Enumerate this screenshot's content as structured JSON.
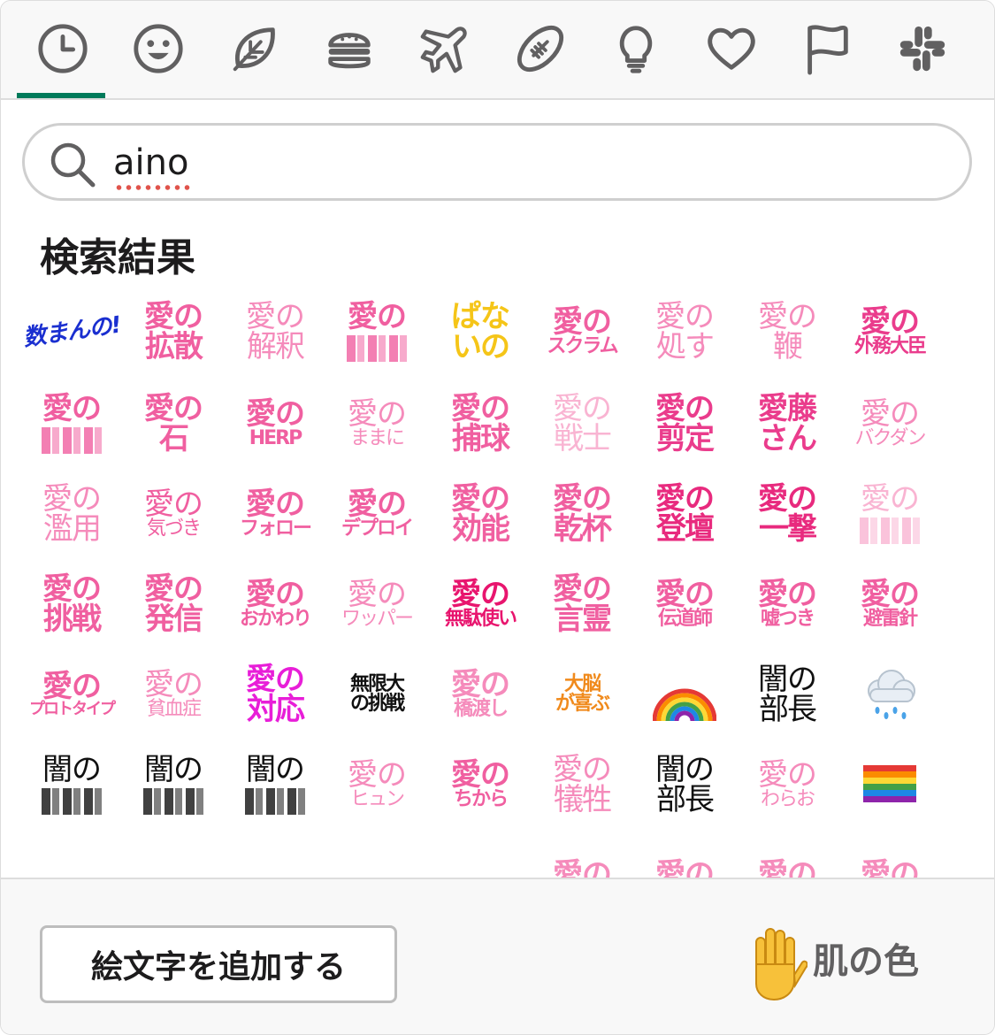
{
  "tabs": [
    {
      "name": "tab-recent",
      "icon": "clock-icon",
      "active": true
    },
    {
      "name": "tab-smileys",
      "icon": "smiley-icon"
    },
    {
      "name": "tab-nature",
      "icon": "leaf-icon"
    },
    {
      "name": "tab-food",
      "icon": "burger-icon"
    },
    {
      "name": "tab-travel",
      "icon": "airplane-icon"
    },
    {
      "name": "tab-activity",
      "icon": "football-icon"
    },
    {
      "name": "tab-objects",
      "icon": "lightbulb-icon"
    },
    {
      "name": "tab-symbols",
      "icon": "heart-icon"
    },
    {
      "name": "tab-flags",
      "icon": "flag-icon"
    },
    {
      "name": "tab-custom",
      "icon": "slack-icon"
    }
  ],
  "search": {
    "value": "aino",
    "placeholder": ""
  },
  "results": {
    "title": "検索結果",
    "items": [
      {
        "l1": "数まんの!",
        "l2": "",
        "color": "#1a2fd0",
        "style": "italic"
      },
      {
        "l1": "愛の",
        "l2": "拡散",
        "color": "#f05fa0"
      },
      {
        "l1": "愛の",
        "l2": "解釈",
        "color": "#f58bbb",
        "thin": true
      },
      {
        "l1": "愛の",
        "l2": "",
        "color": "#f05fa0",
        "blur": true
      },
      {
        "l1": "ぱな",
        "l2": "いの",
        "color": "#f5c518"
      },
      {
        "l1": "愛の",
        "l2": "スクラム",
        "color": "#f05fa0",
        "l2size": "sm"
      },
      {
        "l1": "愛の",
        "l2": "処す",
        "color": "#f58bbb",
        "thin": true
      },
      {
        "l1": "愛の",
        "l2": "鞭",
        "color": "#f58bbb",
        "thin": true
      },
      {
        "l1": "愛の",
        "l2": "外務大臣",
        "color": "#ea3c8c",
        "l2size": "sm"
      },
      {
        "l1": "愛の",
        "l2": "",
        "color": "#f05fa0",
        "blur": true
      },
      {
        "l1": "愛の",
        "l2": "石",
        "color": "#f05fa0"
      },
      {
        "l1": "愛の",
        "l2": "HERP",
        "color": "#f05fa0",
        "l2size": "sm"
      },
      {
        "l1": "愛の",
        "l2": "ままに",
        "color": "#f58bbb",
        "thin": true,
        "l2size": "sm"
      },
      {
        "l1": "愛の",
        "l2": "捕球",
        "color": "#f05fa0"
      },
      {
        "l1": "愛の",
        "l2": "戦士",
        "color": "#f9b4d2",
        "thin": true
      },
      {
        "l1": "愛の",
        "l2": "剪定",
        "color": "#ea3c8c"
      },
      {
        "l1": "愛藤",
        "l2": "さん",
        "color": "#ea3c8c"
      },
      {
        "l1": "愛の",
        "l2": "バクダン",
        "color": "#f58bbb",
        "thin": true,
        "l2size": "sm"
      },
      {
        "l1": "愛の",
        "l2": "濫用",
        "color": "#f58bbb",
        "thin": true
      },
      {
        "l1": "愛の",
        "l2": "気づき",
        "color": "#f05fa0",
        "thin": true,
        "l2size": "sm"
      },
      {
        "l1": "愛の",
        "l2": "フォロー",
        "color": "#f05fa0",
        "l2size": "sm"
      },
      {
        "l1": "愛の",
        "l2": "デプロイ",
        "color": "#f05fa0",
        "l2size": "sm"
      },
      {
        "l1": "愛の",
        "l2": "効能",
        "color": "#f05fa0"
      },
      {
        "l1": "愛の",
        "l2": "乾杯",
        "color": "#f05fa0"
      },
      {
        "l1": "愛の",
        "l2": "登壇",
        "color": "#e82a7e"
      },
      {
        "l1": "愛の",
        "l2": "一撃",
        "color": "#e82a7e"
      },
      {
        "l1": "愛の",
        "l2": "",
        "color": "#f9b4d2",
        "thin": true,
        "blur": true
      },
      {
        "l1": "愛の",
        "l2": "挑戦",
        "color": "#f05fa0"
      },
      {
        "l1": "愛の",
        "l2": "発信",
        "color": "#f05fa0"
      },
      {
        "l1": "愛の",
        "l2": "おかわり",
        "color": "#f05fa0",
        "l2size": "sm"
      },
      {
        "l1": "愛の",
        "l2": "ワッパー",
        "color": "#f58bbb",
        "thin": true,
        "l2size": "sm"
      },
      {
        "l1": "愛の",
        "l2": "無駄使い",
        "color": "#e8156e",
        "l2size": "sm"
      },
      {
        "l1": "愛の",
        "l2": "言霊",
        "color": "#f05fa0"
      },
      {
        "l1": "愛の",
        "l2": "伝道師",
        "color": "#f05fa0",
        "l2size": "sm"
      },
      {
        "l1": "愛の",
        "l2": "嘘つき",
        "color": "#f05fa0",
        "l2size": "sm"
      },
      {
        "l1": "愛の",
        "l2": "避雷針",
        "color": "#f05fa0",
        "l2size": "sm"
      },
      {
        "l1": "愛の",
        "l2": "プロトタイプ",
        "color": "#f05fa0",
        "l2size": "xs"
      },
      {
        "l1": "愛の",
        "l2": "貧血症",
        "color": "#f58bbb",
        "thin": true,
        "l2size": "sm"
      },
      {
        "l1": "愛の",
        "l2": "対応",
        "color": "#e81ed8"
      },
      {
        "l1": "無限大",
        "l2": "の挑戦",
        "color": "#111111",
        "l1size": "sm",
        "l2size": "sm"
      },
      {
        "l1": "愛の",
        "l2": "橋渡し",
        "color": "#f58bbb",
        "l2size": "sm"
      },
      {
        "l1": "大脳",
        "l2": "が喜ぶ",
        "color": "#f08a1c",
        "l1size": "sm",
        "l2size": "sm"
      },
      {
        "l1": "",
        "l2": "",
        "emoji": "rainbow-emoji"
      },
      {
        "l1": "闇の",
        "l2": "部長",
        "color": "#111111",
        "thin": true
      },
      {
        "l1": "",
        "l2": "",
        "emoji": "rain-cloud-emoji"
      },
      {
        "l1": "闇の",
        "l2": "",
        "color": "#111111",
        "thin": true,
        "blur": true
      },
      {
        "l1": "闇の",
        "l2": "",
        "color": "#111111",
        "thin": true,
        "blur": true
      },
      {
        "l1": "闇の",
        "l2": "",
        "color": "#111111",
        "thin": true,
        "blur": true
      },
      {
        "l1": "愛の",
        "l2": "ヒュン",
        "color": "#f58bbb",
        "thin": true,
        "l2size": "sm"
      },
      {
        "l1": "愛の",
        "l2": "ちから",
        "color": "#f05fa0",
        "l2size": "sm"
      },
      {
        "l1": "愛の",
        "l2": "犠牲",
        "color": "#f58bbb",
        "thin": true
      },
      {
        "l1": "闇の",
        "l2": "部長",
        "color": "#111111",
        "thin": true
      },
      {
        "l1": "愛の",
        "l2": "わらお",
        "color": "#f58bbb",
        "thin": true,
        "l2size": "sm"
      },
      {
        "l1": "",
        "l2": "",
        "emoji": "rainbow-flag-emoji"
      },
      {
        "l1": "",
        "l2": "",
        "emoji": "psychedelic-emoji"
      },
      {
        "l1": "",
        "l2": "",
        "emoji": "magenta-bars-emoji"
      },
      {
        "l1": "",
        "l2": "",
        "emoji": "orange-dot-emoji"
      },
      {
        "l1": "",
        "l2": "",
        "emoji": "blue-creature-emoji"
      },
      {
        "l1": "",
        "l2": "",
        "emoji": "yellow-box-emoji"
      },
      {
        "l1": "愛の",
        "l2": "",
        "color": "#f58bbb"
      },
      {
        "l1": "愛の",
        "l2": "",
        "color": "#f58bbb"
      },
      {
        "l1": "愛の",
        "l2": "",
        "color": "#f58bbb"
      },
      {
        "l1": "愛の",
        "l2": "",
        "color": "#f58bbb"
      }
    ]
  },
  "footer": {
    "add_emoji_label": "絵文字を追加する",
    "skin_tone_label": "肌の色",
    "skin_tone_icon": "raised-hand-icon"
  },
  "colors": {
    "accent": "#007a5a",
    "border": "#dddddd",
    "icon": "#616061"
  }
}
